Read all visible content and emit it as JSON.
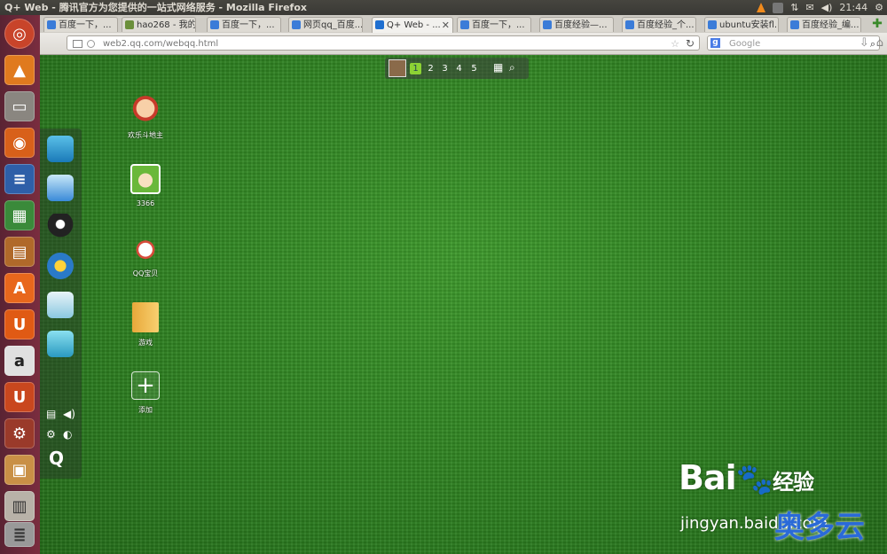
{
  "window": {
    "title": "Q+ Web - 腾讯官方为您提供的一站式网络服务 - Mozilla Firefox"
  },
  "tray": {
    "time": "21:44"
  },
  "tabs": [
    {
      "label": "百度一下，..."
    },
    {
      "label": "hao268 - 我的..."
    },
    {
      "label": "百度一下，..."
    },
    {
      "label": "网页qq_百度..."
    },
    {
      "label": "Q+ Web - ...",
      "active": true
    },
    {
      "label": "百度一下，..."
    },
    {
      "label": "百度经验—..."
    },
    {
      "label": "百度经验_个..."
    },
    {
      "label": "ubuntu安装fl..."
    },
    {
      "label": "百度经验_编..."
    }
  ],
  "address": {
    "url": "web2.qq.com/webqq.html"
  },
  "search": {
    "placeholder": "Google",
    "engine_icon": "google-icon"
  },
  "dock": {
    "pages": [
      "1",
      "2",
      "3",
      "4",
      "5"
    ],
    "current_page": "1"
  },
  "desktop_icons": [
    {
      "label": "欢乐斗地主"
    },
    {
      "label": "3366"
    },
    {
      "label": "QQ宝贝"
    },
    {
      "label": "游戏"
    },
    {
      "label": "添加"
    }
  ],
  "watermark": {
    "brand": "Bai",
    "brand_suffix": "经验",
    "url": "jingyan.baidu.com",
    "overlay": "奥多云"
  },
  "colors": {
    "launcher": "#6b2838",
    "grass": "#2e8523",
    "accent_green": "#8cd234"
  }
}
